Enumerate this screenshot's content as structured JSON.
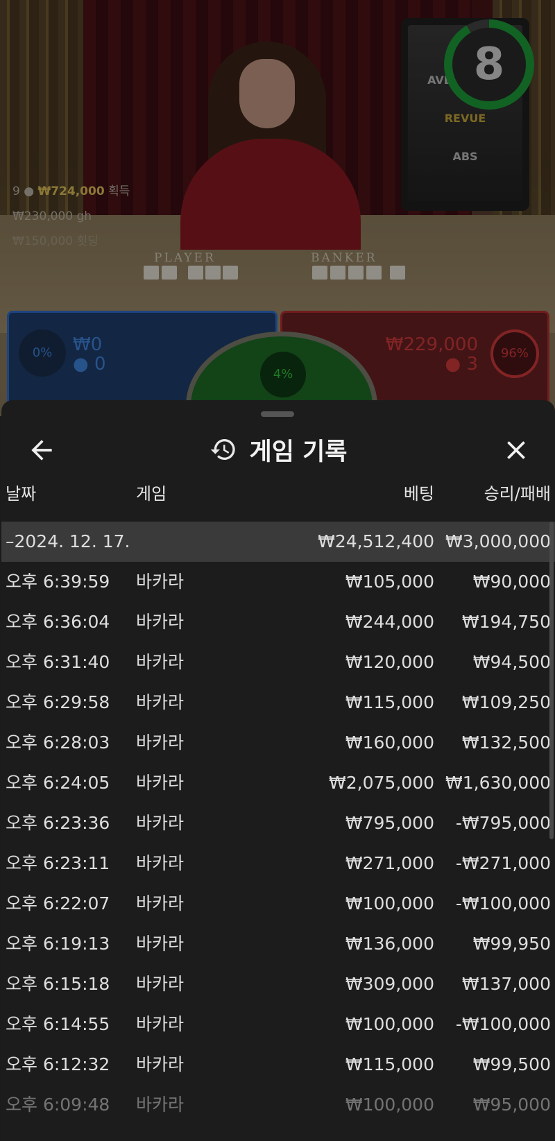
{
  "scene": {
    "timer": "8",
    "player_pct": "0%",
    "player_amount": "₩0",
    "player_count": "0",
    "tie_pct": "4%",
    "banker_amount": "₩229,000",
    "banker_count": "3",
    "banker_pct": "96%",
    "table_label_player": "PLAYER",
    "table_label_banker": "BANKER",
    "screen_logos": [
      "AVE CASINO",
      "REVUE",
      "ABS"
    ],
    "winners": [
      {
        "rank": "9",
        "amount": "₩724,000",
        "note": "획득"
      },
      {
        "amount": "₩230,000",
        "note": "gh"
      },
      {
        "amount": "₩150,000",
        "note": "횟딩"
      }
    ]
  },
  "panel": {
    "title": "게임 기록",
    "columns": {
      "date": "날짜",
      "game": "게임",
      "bet": "베팅",
      "result": "승리/패배"
    },
    "group": {
      "date": "–2024. 12. 17.",
      "bet": "₩24,512,400",
      "result": "₩3,000,000"
    },
    "rows": [
      {
        "time": "오후 6:39:59",
        "game": "바카라",
        "bet": "₩105,000",
        "result": "₩90,000"
      },
      {
        "time": "오후 6:36:04",
        "game": "바카라",
        "bet": "₩244,000",
        "result": "₩194,750"
      },
      {
        "time": "오후 6:31:40",
        "game": "바카라",
        "bet": "₩120,000",
        "result": "₩94,500"
      },
      {
        "time": "오후 6:29:58",
        "game": "바카라",
        "bet": "₩115,000",
        "result": "₩109,250"
      },
      {
        "time": "오후 6:28:03",
        "game": "바카라",
        "bet": "₩160,000",
        "result": "₩132,500"
      },
      {
        "time": "오후 6:24:05",
        "game": "바카라",
        "bet": "₩2,075,000",
        "result": "₩1,630,000"
      },
      {
        "time": "오후 6:23:36",
        "game": "바카라",
        "bet": "₩795,000",
        "result": "-₩795,000"
      },
      {
        "time": "오후 6:23:11",
        "game": "바카라",
        "bet": "₩271,000",
        "result": "-₩271,000"
      },
      {
        "time": "오후 6:22:07",
        "game": "바카라",
        "bet": "₩100,000",
        "result": "-₩100,000"
      },
      {
        "time": "오후 6:19:13",
        "game": "바카라",
        "bet": "₩136,000",
        "result": "₩99,950"
      },
      {
        "time": "오후 6:15:18",
        "game": "바카라",
        "bet": "₩309,000",
        "result": "₩137,000"
      },
      {
        "time": "오후 6:14:55",
        "game": "바카라",
        "bet": "₩100,000",
        "result": "-₩100,000"
      },
      {
        "time": "오후 6:12:32",
        "game": "바카라",
        "bet": "₩115,000",
        "result": "₩99,500"
      },
      {
        "time": "오후 6:09:48",
        "game": "바카라",
        "bet": "₩100,000",
        "result": "₩95,000"
      }
    ]
  },
  "icons": {
    "back": "arrow-left-icon",
    "history": "history-icon",
    "close": "close-icon"
  },
  "colors": {
    "panel_bg": "#1c1c1c",
    "group_row_bg": "#3a3a3a",
    "text": "#dedede",
    "player_blue": "#2e6fcf",
    "banker_red": "#b6302f",
    "timer_green": "#1d9e3a"
  }
}
